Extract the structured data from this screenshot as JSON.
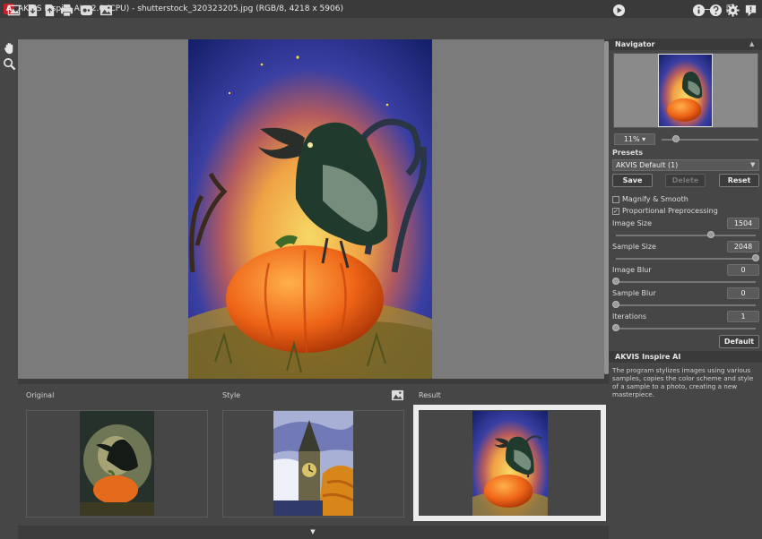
{
  "window": {
    "title": "AKVIS Inspire AI v.2.0 (CPU) - shutterstock_320323205.jpg (RGB/8, 4218 x 5906)",
    "logo_letter": "A",
    "minimize": "—",
    "maximize": "☐",
    "close": "✕"
  },
  "toolbar": {
    "left_icons": [
      "open-image-icon",
      "load-style-icon",
      "save-icon",
      "print-icon",
      "share-icon",
      "image-gallery-icon"
    ],
    "right_icons": [
      "run-icon",
      "info-icon",
      "help-icon",
      "settings-icon",
      "notifications-icon"
    ]
  },
  "tools": [
    "hand-tool-icon",
    "zoom-tool-icon"
  ],
  "bottom": {
    "original_label": "Original",
    "style_label": "Style",
    "result_label": "Result",
    "expand": "▼"
  },
  "navigator": {
    "title": "Navigator",
    "zoom_value": "11%",
    "zoom_slider_fraction": 0.15
  },
  "presets": {
    "title": "Presets",
    "selected": "AKVIS Default (1)",
    "save_label": "Save",
    "delete_label": "Delete",
    "reset_label": "Reset"
  },
  "settings": {
    "magnify_smooth": {
      "label": "Magnify & Smooth",
      "checked": false
    },
    "proportional_preprocessing": {
      "label": "Proportional Preprocessing",
      "checked": true
    },
    "image_size": {
      "label": "Image Size",
      "value": "1504",
      "fraction": 0.68
    },
    "sample_size": {
      "label": "Sample Size",
      "value": "2048",
      "fraction": 1.0
    },
    "image_blur": {
      "label": "Image Blur",
      "value": "0",
      "fraction": 0.0
    },
    "sample_blur": {
      "label": "Sample Blur",
      "value": "0",
      "fraction": 0.0
    },
    "iterations": {
      "label": "Iterations",
      "value": "1",
      "fraction": 0.0
    },
    "default_label": "Default"
  },
  "info": {
    "title": "AKVIS Inspire AI",
    "text": "The program stylizes images using various samples, copies the color scheme and style of a sample to a photo, creating a new masterpiece."
  },
  "colors": {
    "background": "#464646",
    "canvas": "#7b7b7b",
    "title_bar": "#3a3a3a",
    "result_highlight": "#ececec",
    "logo": "#c8202a"
  }
}
